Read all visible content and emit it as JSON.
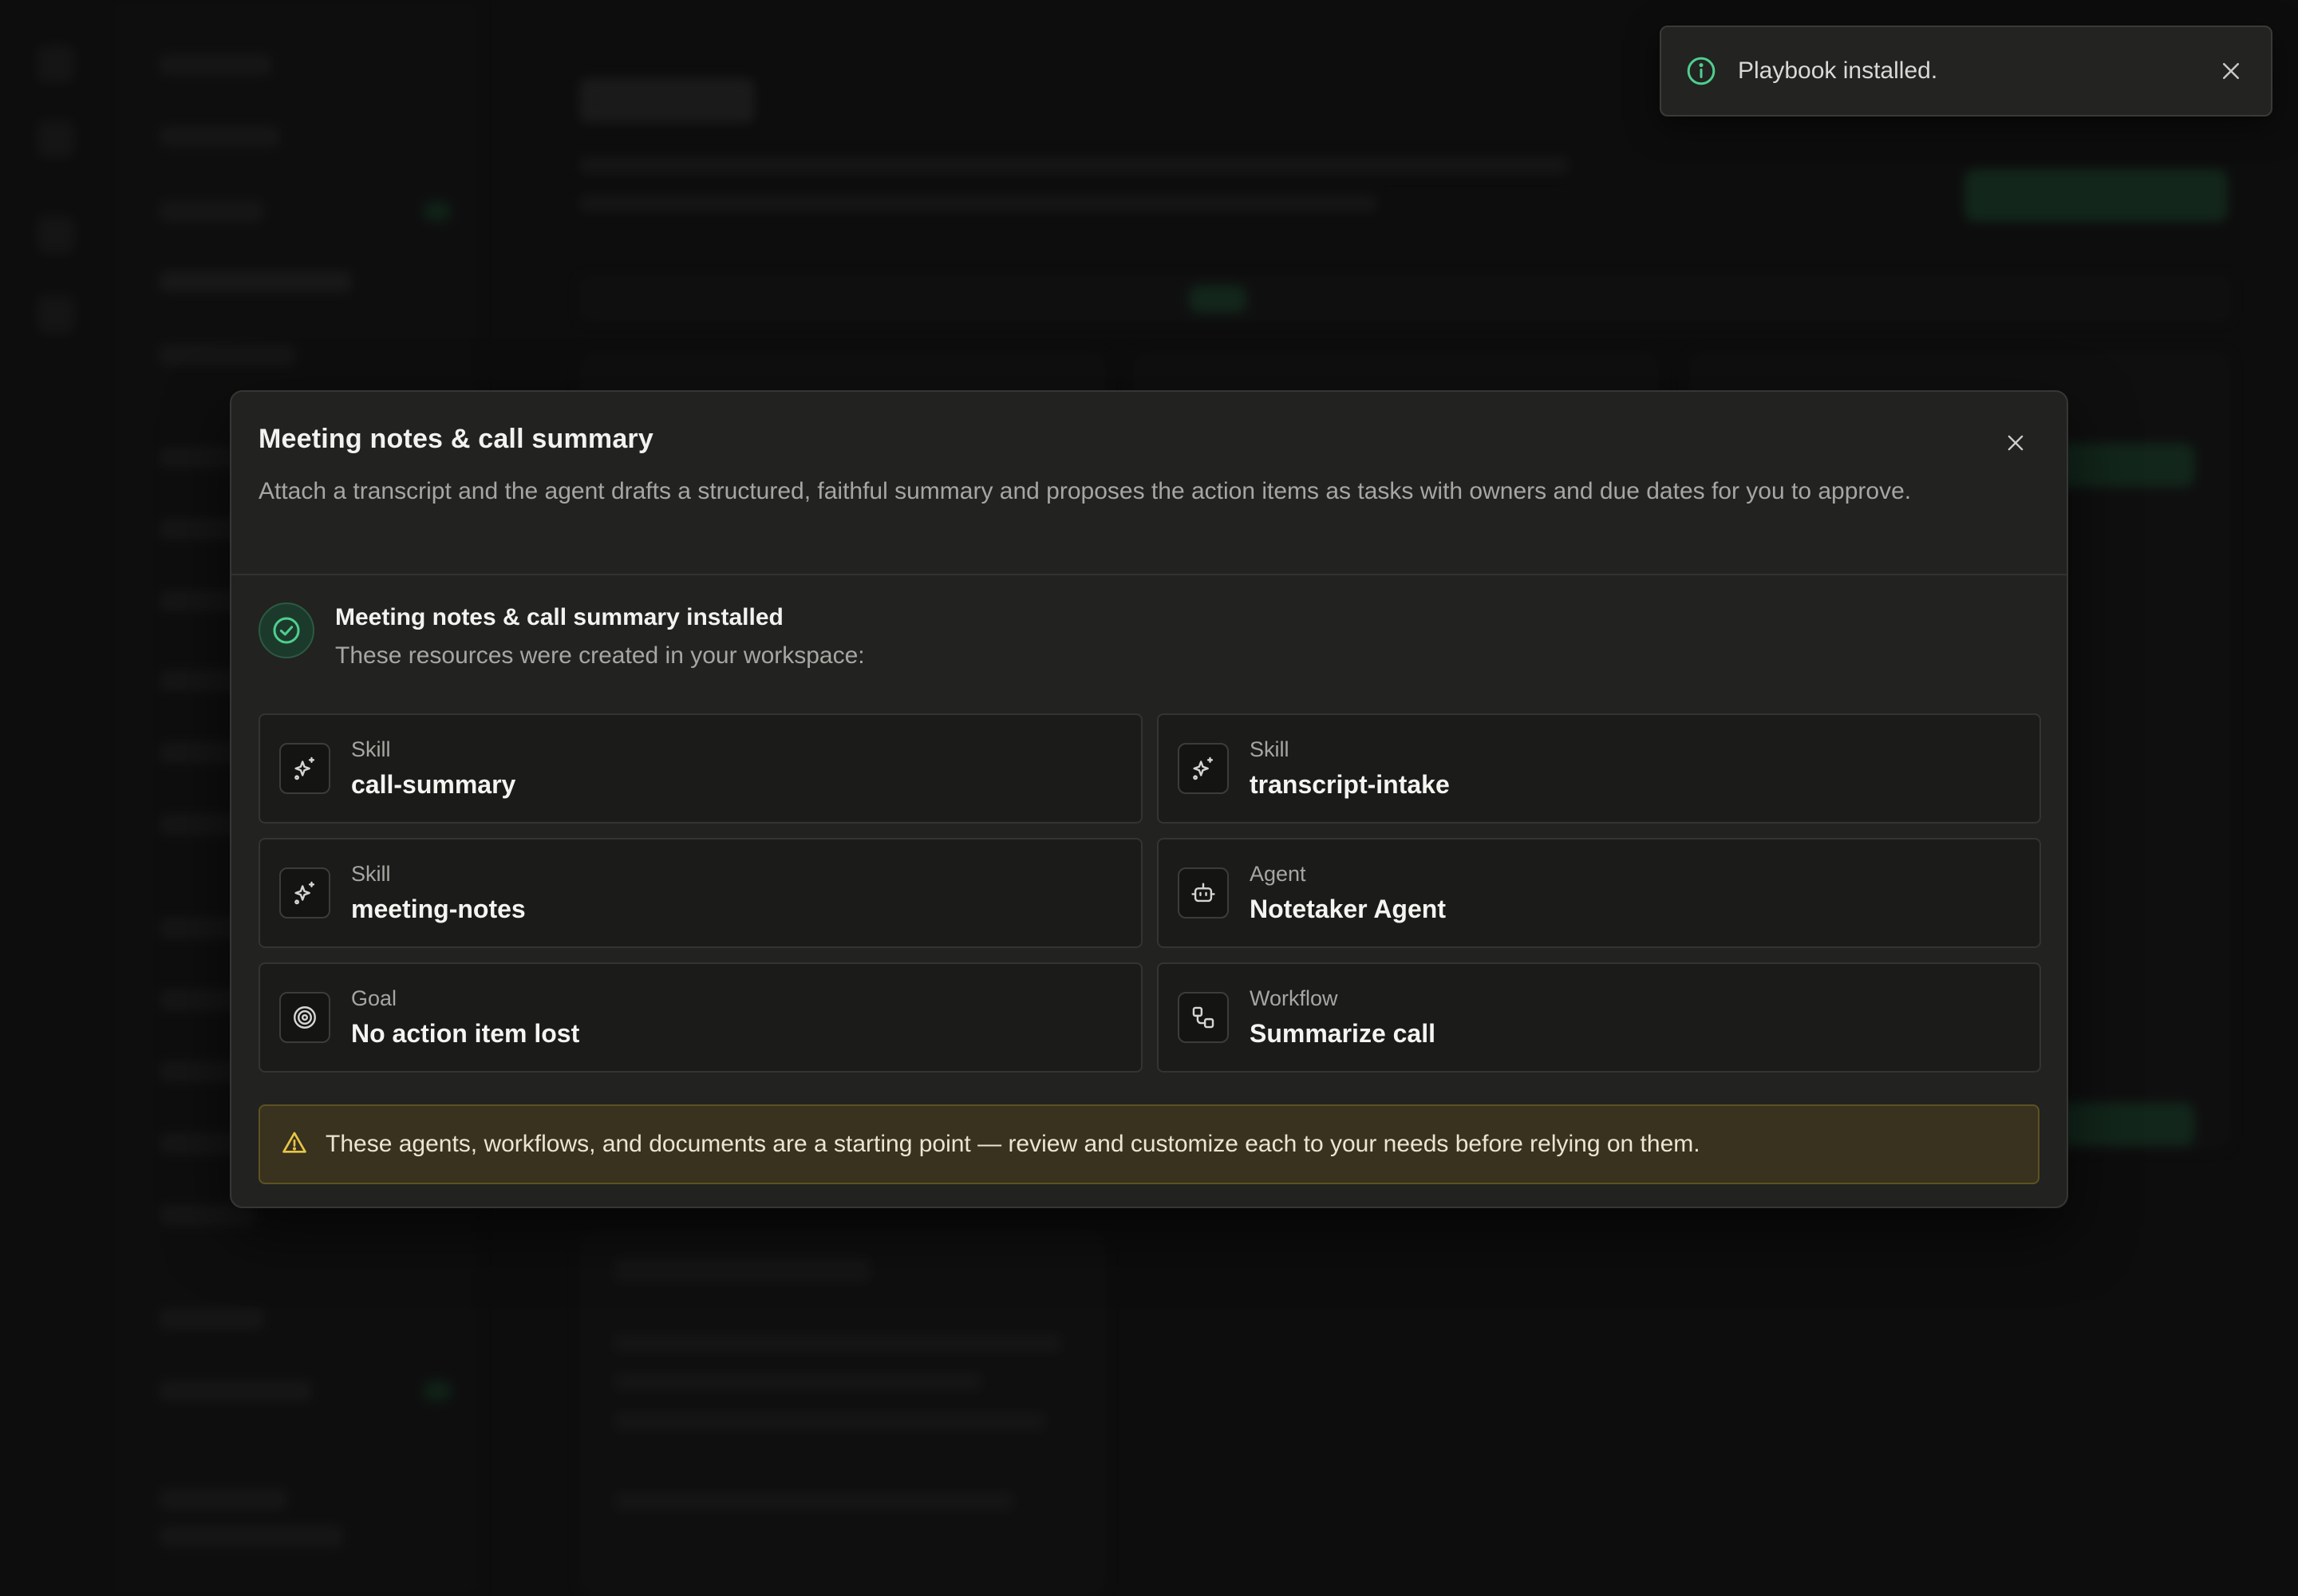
{
  "toast": {
    "message": "Playbook installed."
  },
  "modal": {
    "title": "Meeting notes & call summary",
    "description": "Attach a transcript and the agent drafts a structured, faithful summary and proposes the action items as tasks with owners and due dates for you to approve.",
    "installed_title": "Meeting notes & call summary installed",
    "installed_subtitle": "These resources were created in your workspace:",
    "resources": [
      {
        "type": "Skill",
        "name": "call-summary",
        "icon": "sparkle-icon"
      },
      {
        "type": "Skill",
        "name": "transcript-intake",
        "icon": "sparkle-icon"
      },
      {
        "type": "Skill",
        "name": "meeting-notes",
        "icon": "sparkle-icon"
      },
      {
        "type": "Agent",
        "name": "Notetaker Agent",
        "icon": "robot-icon"
      },
      {
        "type": "Goal",
        "name": "No action item lost",
        "icon": "target-icon"
      },
      {
        "type": "Workflow",
        "name": "Summarize call",
        "icon": "workflow-icon"
      }
    ],
    "warning": "These agents, workflows, and documents are a starting point — review and customize each to your needs before relying on them."
  },
  "colors": {
    "accent": "#4fcf8e",
    "warning_bg": "#38321f",
    "warning_icon": "#e8c547",
    "panel": "#222221"
  }
}
